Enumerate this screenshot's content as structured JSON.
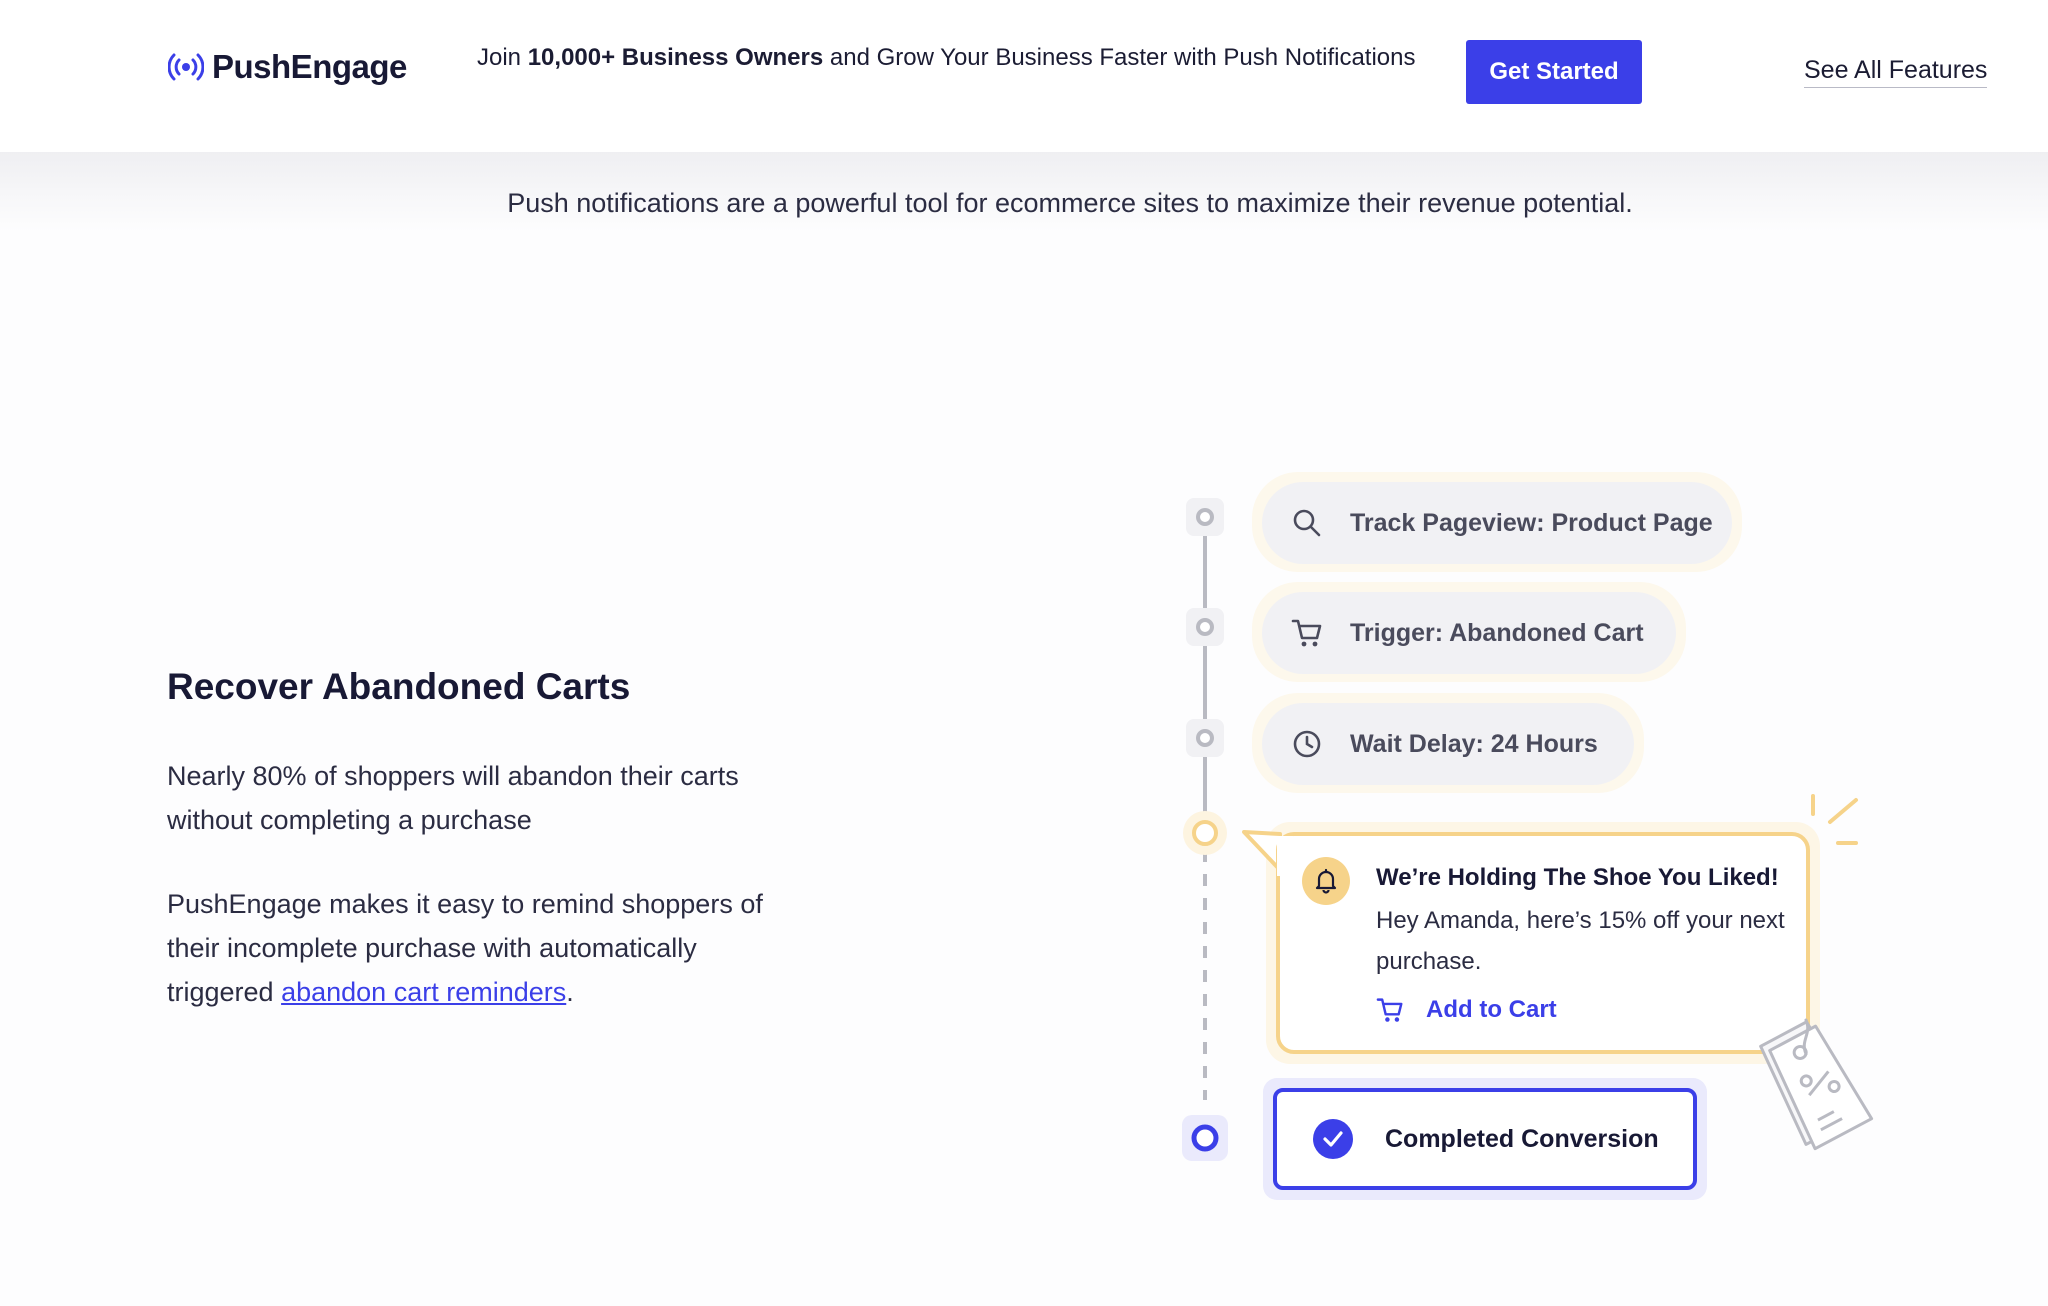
{
  "header": {
    "logo_text": "PushEngage",
    "promo": {
      "prefix": "Join ",
      "count": "10,000+",
      "mid": " Business Owners",
      "suffix": " and Grow Your Business Faster with Push Notifications"
    },
    "cta_label": "Get Started",
    "see_all_label": "See All Features"
  },
  "tagline": "Push notifications are a powerful tool for ecommerce sites to maximize their revenue potential.",
  "section": {
    "title": "Recover Abandoned Carts",
    "paragraph1": "Nearly 80% of shoppers will abandon their carts without completing a purchase",
    "paragraph2_prefix": "PushEngage makes it easy to remind shoppers of their incomplete purchase with automatically triggered ",
    "paragraph2_link": "abandon cart reminders",
    "paragraph2_suffix": "."
  },
  "flow": {
    "steps": [
      {
        "icon": "search-icon",
        "label": "Track Pageview: Product Page"
      },
      {
        "icon": "cart-icon",
        "label": "Trigger: Abandoned Cart"
      },
      {
        "icon": "clock-icon",
        "label": "Wait Delay: 24 Hours"
      }
    ],
    "notification": {
      "icon": "bell-icon",
      "title": "We’re Holding The Shoe You Liked!",
      "body": "Hey Amanda, here’s 15% off your next purchase.",
      "action_label": "Add to Cart"
    },
    "conversion_label": "Completed Conversion"
  },
  "colors": {
    "brand": "#3b3fe8",
    "notification_border": "#f6d38a",
    "step_bg": "#f1f1f4",
    "timeline_gray": "#b9bac2"
  }
}
